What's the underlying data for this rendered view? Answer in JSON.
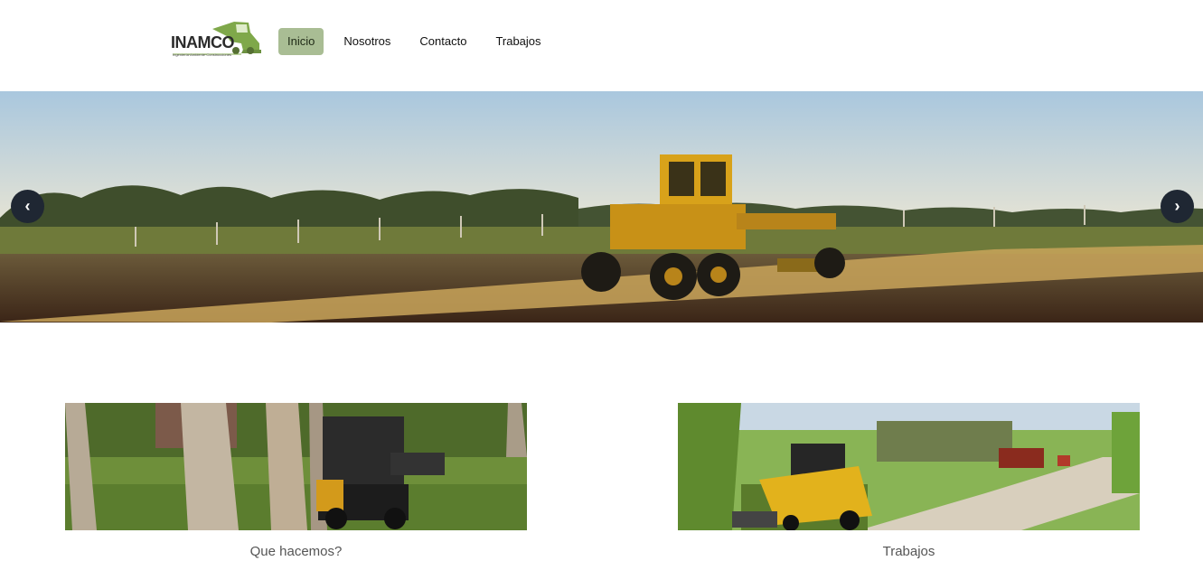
{
  "brand": {
    "name": "INAMCO",
    "tagline": "Ingeniería·Ambiente·Construcciones"
  },
  "nav": {
    "items": [
      {
        "label": "Inicio",
        "active": true
      },
      {
        "label": "Nosotros",
        "active": false
      },
      {
        "label": "Contacto",
        "active": false
      },
      {
        "label": "Trabajos",
        "active": false
      }
    ]
  },
  "carousel": {
    "prev_icon": "chevron-left-icon",
    "next_icon": "chevron-right-icon",
    "prev_glyph": "‹",
    "next_glyph": "›"
  },
  "cards": [
    {
      "title": "Que hacemos?"
    },
    {
      "title": "Trabajos"
    }
  ],
  "colors": {
    "nav_active_bg": "#a9bd94",
    "arrow_bg": "#1f2733"
  }
}
